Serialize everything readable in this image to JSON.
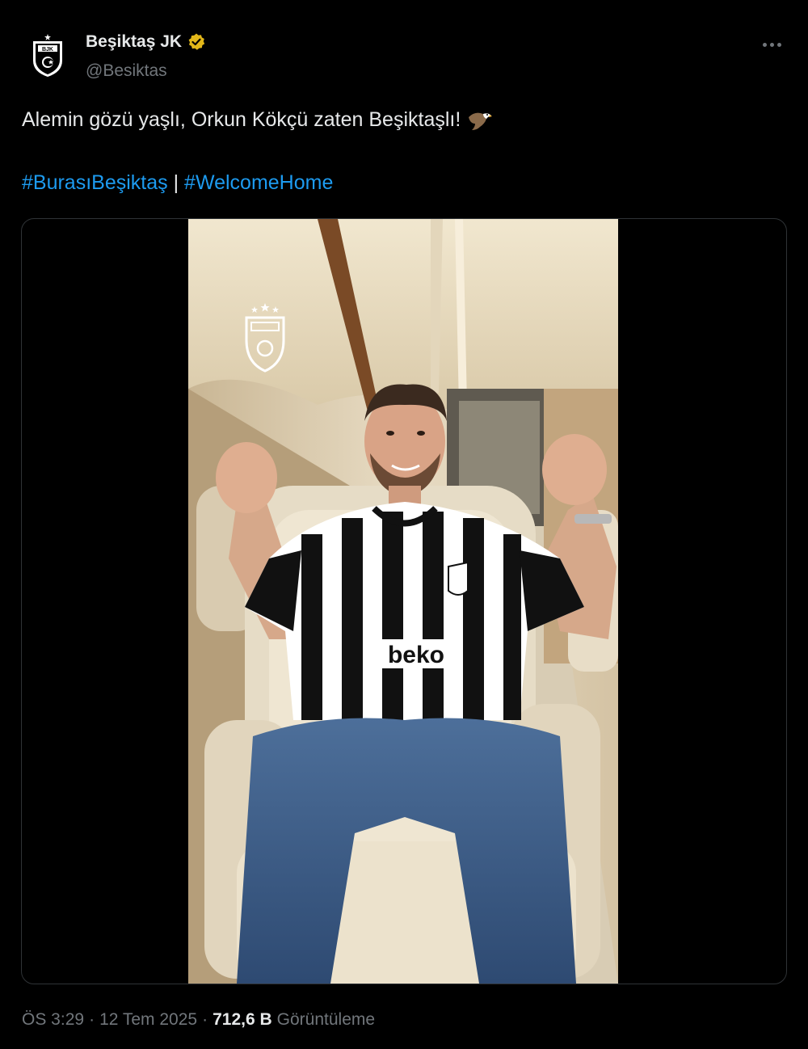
{
  "account": {
    "display_name": "Beşiktaş JK",
    "handle": "@Besiktas",
    "verified_icon": "gold-verified-badge",
    "avatar_icon": "besiktas-crest"
  },
  "tweet": {
    "text": "Alemin gözü yaşlı, Orkun Kökçü zaten Beşiktaşlı!",
    "emoji_icon": "eagle-icon",
    "hashtags": [
      "#BurasıBeşiktaş",
      "#WelcomeHome"
    ],
    "hashtag_separator": "|"
  },
  "media": {
    "type": "video",
    "overlay_logo": "besiktas-crest",
    "jersey_sponsor": "beko"
  },
  "footer": {
    "time": "ÖS 3:29",
    "date": "12 Tem 2025",
    "sep": "·",
    "views_count": "712,6 B",
    "views_label": "Görüntüleme"
  },
  "colors": {
    "background": "#000000",
    "text": "#e7e9ea",
    "secondary": "#71767b",
    "link": "#1d9bf0",
    "verified": "#e2b719",
    "border": "#2f3336"
  }
}
